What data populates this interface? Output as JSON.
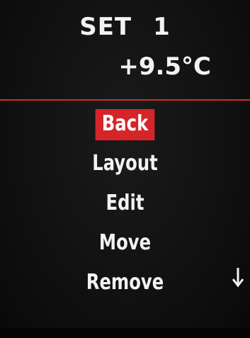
{
  "header": {
    "title_word": "SET",
    "title_number": "1",
    "temperature": "+9.5°C"
  },
  "menu": {
    "items": [
      {
        "label": "Back",
        "selected": true
      },
      {
        "label": "Layout",
        "selected": false
      },
      {
        "label": "Edit",
        "selected": false
      },
      {
        "label": "Move",
        "selected": false
      },
      {
        "label": "Remove",
        "selected": false
      }
    ]
  },
  "colors": {
    "highlight": "#d52528",
    "divider": "#d22a2a",
    "text": "#f2f2f2",
    "background": "#121112"
  },
  "icons": {
    "scroll": "arrow-down-icon"
  }
}
